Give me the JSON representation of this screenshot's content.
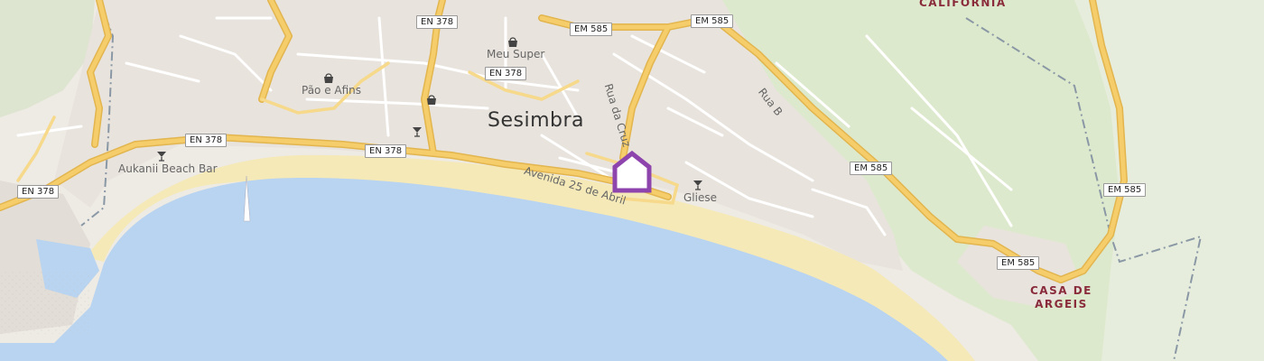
{
  "map": {
    "town": "Sesimbra",
    "places": {
      "meu_super": "Meu Super",
      "pao_e_afins": "Pão e Afins",
      "aukanii": "Aukanii Beach Bar",
      "gliese": "Gliese"
    },
    "streets": {
      "rua_da_cruz": "Rua da Cruz",
      "avenida": "Avenida 25 de Abril",
      "rua_b": "Rua B"
    },
    "regions": {
      "california": "CALIFÓRNIA",
      "casa_de_argeis_1": "CASA DE",
      "casa_de_argeis_2": "ARGEIS"
    },
    "shields": {
      "en378": "EN 378",
      "em585": "EM 585"
    },
    "colors": {
      "land": "#eeeae4",
      "water": "#b9d4f0",
      "beach": "#f5e9b8",
      "park": "#dde9cc",
      "road": "#f6cd6b",
      "marker": "#8e44ad"
    },
    "icons": [
      "shop-icon",
      "shop-icon",
      "shop-icon",
      "bar-icon",
      "bar-icon",
      "bar-icon",
      "location-marker-icon"
    ]
  }
}
